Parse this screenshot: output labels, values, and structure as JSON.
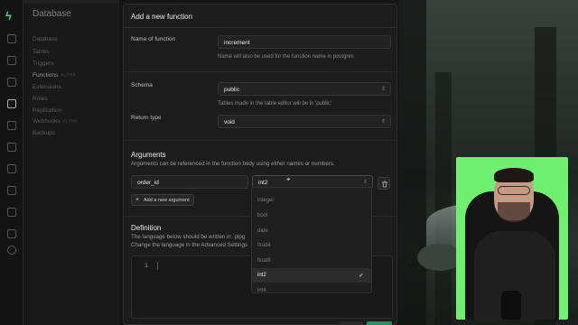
{
  "sidebar": {
    "title": "Database",
    "items": [
      {
        "label": "Database"
      },
      {
        "label": "Tables"
      },
      {
        "label": "Triggers"
      },
      {
        "label": "Functions",
        "tag": "ALPHA"
      },
      {
        "label": "Extensions"
      },
      {
        "label": "Roles"
      },
      {
        "label": "Replication"
      },
      {
        "label": "Webhooks",
        "tag": "ALPHA"
      },
      {
        "label": "Backups"
      }
    ]
  },
  "modal": {
    "title": "Add a new function",
    "name_label": "Name of function",
    "name_value": "increment",
    "name_help": "Name will also be used for the function name in postgres",
    "schema_label": "Schema",
    "schema_value": "public",
    "schema_help": "Tables made in the table editor will be in 'public'",
    "return_label": "Return type",
    "return_value": "void",
    "arguments_title": "Arguments",
    "arguments_desc": "Arguments can be referenced in the function body using either names or numbers.",
    "arg_name_value": "order_id",
    "arg_type_value": "int2",
    "add_argument_label": "Add a new argument",
    "definition_title": "Definition",
    "definition_desc1": "The language below should be written in `plpg",
    "definition_desc2": "Change the language in the Advanced Settings",
    "editor_line": "1"
  },
  "dropdown": {
    "options": [
      "integer",
      "bool",
      "date",
      "float4",
      "float8",
      "int2",
      "int4"
    ],
    "selected": "int2"
  },
  "colors": {
    "accent": "#3ecf8e",
    "background": "#1c1c1c"
  }
}
